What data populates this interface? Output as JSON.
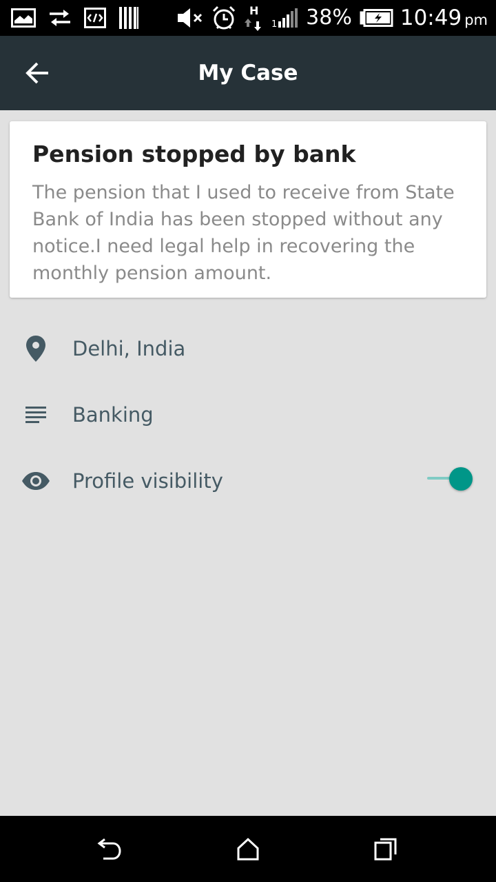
{
  "status_bar": {
    "battery": "38%",
    "time": "10:49",
    "ampm": "pm",
    "icons": [
      "image-icon",
      "sync-arrows-icon",
      "code-icon",
      "barcode-icon",
      "mute-icon",
      "alarm-icon",
      "data-hplus-icon",
      "signal-icon",
      "battery-charging-icon"
    ]
  },
  "app_bar": {
    "title": "My Case",
    "back_icon": "arrow-back-icon"
  },
  "case": {
    "title": "Pension stopped by bank",
    "description": "The pension that I used to receive from State Bank of India has been stopped without any notice.I need legal help in recovering the monthly pension amount."
  },
  "details": {
    "location": {
      "icon": "location-pin-icon",
      "label": "Delhi, India"
    },
    "category": {
      "icon": "subject-lines-icon",
      "label": "Banking"
    },
    "visibility": {
      "icon": "eye-icon",
      "label": "Profile visibility",
      "enabled": true
    }
  },
  "nav_bar": {
    "icons": [
      "back-icon",
      "home-icon",
      "recent-apps-icon"
    ]
  },
  "colors": {
    "app_bar": "#263238",
    "background": "#e1e1e1",
    "accent": "#009688",
    "icon": "#455a64"
  }
}
